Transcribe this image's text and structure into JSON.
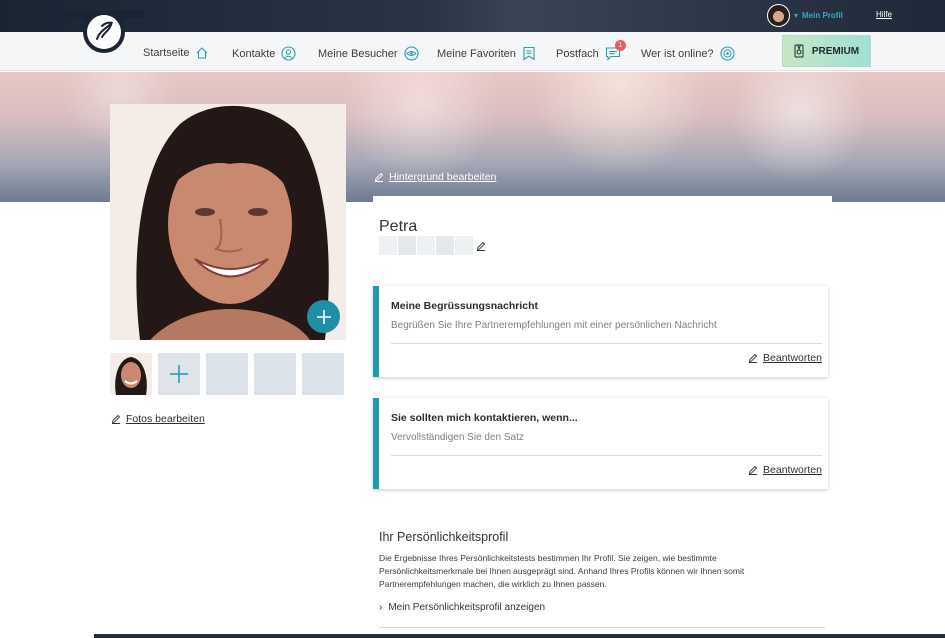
{
  "topbar": {
    "profile_label": "Mein Profil",
    "help_label": "Hilfe"
  },
  "nav": {
    "items": [
      {
        "label": "Startseite",
        "icon": "home-icon"
      },
      {
        "label": "Kontakte",
        "icon": "contacts-icon"
      },
      {
        "label": "Meine Besucher",
        "icon": "eye-icon"
      },
      {
        "label": "Meine Favoriten",
        "icon": "bookmark-icon"
      },
      {
        "label": "Postfach",
        "icon": "mail-chat-icon",
        "badge": "1"
      },
      {
        "label": "Wer ist online?",
        "icon": "online-icon"
      }
    ],
    "premium_label": "PREMIUM"
  },
  "banner": {
    "edit_background_label": "Hintergrund bearbeiten"
  },
  "photos": {
    "edit_label": "Fotos bearbeiten"
  },
  "profile": {
    "name": "Petra"
  },
  "cards": [
    {
      "title": "Meine Begrüssungsnachricht",
      "subtitle": "Begrüßen Sie Ihre Partnerempfehlungen mit einer persönlichen Nachricht",
      "action": "Beantworten"
    },
    {
      "title": "Sie sollten mich kontaktieren, wenn...",
      "subtitle": "Vervollständigen Sie den Satz",
      "action": "Beantworten"
    }
  ],
  "personality": {
    "title": "Ihr Persönlichkeitsprofil",
    "text": "Die Ergebnisse Ihres Persönlichkeitstests bestimmen Ihr Profil. Sie zeigen, wie bestimmte Persönlichkeitsmerkmale bei Ihnen ausgeprägt sind. Anhand Ihres Profils können wir Ihnen somit Partnerempfehlungen machen, die wirklich zu Ihnen passen.",
    "link": "Mein Persönlichkeitsprofil anzeigen"
  },
  "colors": {
    "accent": "#1f9ab0",
    "badge": "#ef5b5b",
    "premium_from": "#c8e7c3",
    "premium_to": "#9fdfd6"
  }
}
